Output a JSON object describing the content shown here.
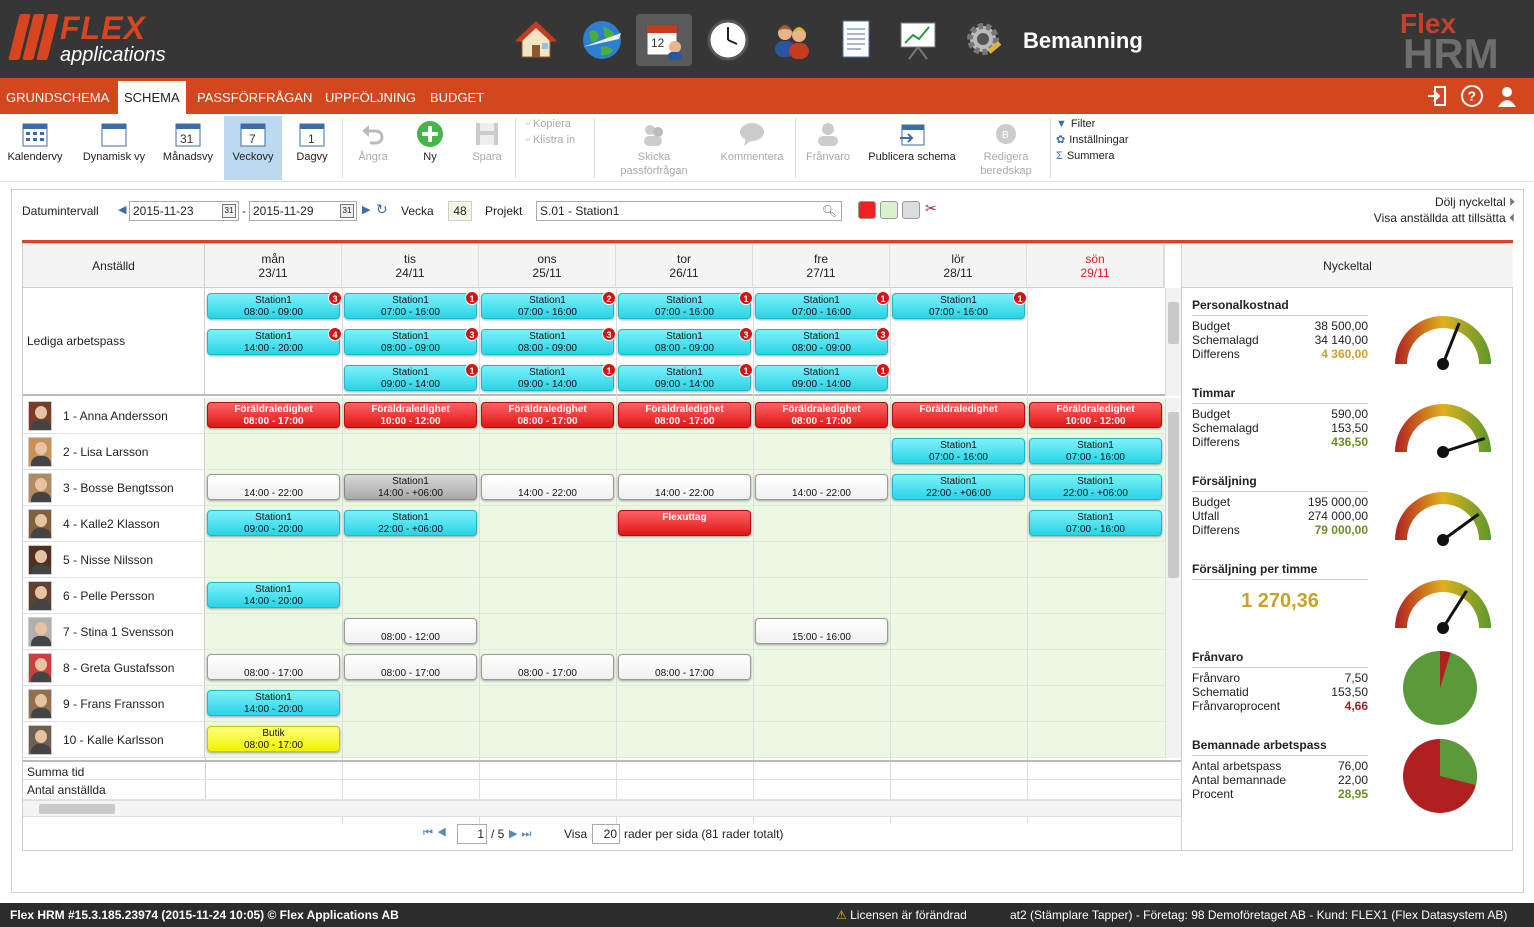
{
  "header": {
    "logo_text": "FLEX",
    "logo_sub": "applications",
    "app_title": "Bemanning",
    "brand_top": "Flex",
    "brand_bottom": "HRM"
  },
  "menu": {
    "tabs": [
      "GRUNDSCHEMA",
      "SCHEMA",
      "PASSFÖRFRÅGAN",
      "UPPFÖLJNING",
      "BUDGET"
    ],
    "active": "SCHEMA"
  },
  "toolbar": {
    "kalendervy": "Kalendervy",
    "dynamisk": "Dynamisk vy",
    "manadsvy": "Månadsvy",
    "veckovy": "Veckovy",
    "dagvy": "Dagvy",
    "angra": "Ångra",
    "ny": "Ny",
    "spara": "Spara",
    "kopiera": "Kopiera",
    "klistra": "Klistra in",
    "skicka1": "Skicka",
    "skicka2": "passförfrågan",
    "kommentera": "Kommentera",
    "franvaro": "Frånvaro",
    "publicera": "Publicera schema",
    "redigera1": "Redigera",
    "redigera2": "beredskap",
    "filter": "Filter",
    "installningar": "Inställningar",
    "summera": "Summera"
  },
  "filter": {
    "datumintervall": "Datumintervall",
    "from": "2015-11-23",
    "to": "2015-11-29",
    "vecka_label": "Vecka",
    "vecka": "48",
    "projekt_label": "Projekt",
    "projekt": "S.01 - Station1",
    "dolj": "Dölj nyckeltal",
    "visa": "Visa anställda att tillsätta"
  },
  "grid": {
    "emp_header": "Anställd",
    "lediga": "Lediga arbetspass",
    "summa": "Summa tid",
    "antal": "Antal anställda",
    "days": [
      {
        "d": "mån",
        "dt": "23/11"
      },
      {
        "d": "tis",
        "dt": "24/11"
      },
      {
        "d": "ons",
        "dt": "25/11"
      },
      {
        "d": "tor",
        "dt": "26/11"
      },
      {
        "d": "fre",
        "dt": "27/11"
      },
      {
        "d": "lör",
        "dt": "28/11"
      },
      {
        "d": "sön",
        "dt": "29/11"
      }
    ],
    "employees": [
      "1 - Anna Andersson",
      "2 - Lisa Larsson",
      "3 - Bosse Bengtsson",
      "4 - Kalle2 Klasson",
      "5 - Nisse Nilsson",
      "6 - Pelle Persson",
      "7 - Stina 1 Svensson",
      "8 - Greta Gustafsson",
      "9 - Frans Fransson",
      "10 - Kalle Karlsson"
    ]
  },
  "open_shifts": [
    {
      "day": 0,
      "slot": 0,
      "t1": "Station1",
      "t2": "08:00 - 09:00",
      "n": "3"
    },
    {
      "day": 1,
      "slot": 0,
      "t1": "Station1",
      "t2": "07:00 - 16:00",
      "n": "1"
    },
    {
      "day": 2,
      "slot": 0,
      "t1": "Station1",
      "t2": "07:00 - 16:00",
      "n": "2"
    },
    {
      "day": 3,
      "slot": 0,
      "t1": "Station1",
      "t2": "07:00 - 16:00",
      "n": "1"
    },
    {
      "day": 4,
      "slot": 0,
      "t1": "Station1",
      "t2": "07:00 - 16:00",
      "n": "1"
    },
    {
      "day": 5,
      "slot": 0,
      "t1": "Station1",
      "t2": "07:00 - 16:00",
      "n": "1"
    },
    {
      "day": 0,
      "slot": 1,
      "t1": "Station1",
      "t2": "14:00 - 20:00",
      "n": "4"
    },
    {
      "day": 1,
      "slot": 1,
      "t1": "Station1",
      "t2": "08:00 - 09:00",
      "n": "3"
    },
    {
      "day": 2,
      "slot": 1,
      "t1": "Station1",
      "t2": "08:00 - 09:00",
      "n": "3"
    },
    {
      "day": 3,
      "slot": 1,
      "t1": "Station1",
      "t2": "08:00 - 09:00",
      "n": "3"
    },
    {
      "day": 4,
      "slot": 1,
      "t1": "Station1",
      "t2": "08:00 - 09:00",
      "n": "3"
    },
    {
      "day": 1,
      "slot": 2,
      "t1": "Station1",
      "t2": "09:00 - 14:00",
      "n": "1"
    },
    {
      "day": 2,
      "slot": 2,
      "t1": "Station1",
      "t2": "09:00 - 14:00",
      "n": "1"
    },
    {
      "day": 3,
      "slot": 2,
      "t1": "Station1",
      "t2": "09:00 - 14:00",
      "n": "1"
    },
    {
      "day": 4,
      "slot": 2,
      "t1": "Station1",
      "t2": "09:00 - 14:00",
      "n": "1"
    }
  ],
  "shifts": [
    {
      "emp": 0,
      "day": 0,
      "c": "rd",
      "t1": "Föräldraledighet",
      "t2": "08:00 - 17:00"
    },
    {
      "emp": 0,
      "day": 1,
      "c": "rd",
      "t1": "Föräldraledighet",
      "t2": "10:00 - 12:00"
    },
    {
      "emp": 0,
      "day": 2,
      "c": "rd",
      "t1": "Föräldraledighet",
      "t2": "08:00 - 17:00"
    },
    {
      "emp": 0,
      "day": 3,
      "c": "rd",
      "t1": "Föräldraledighet",
      "t2": "08:00 - 17:00"
    },
    {
      "emp": 0,
      "day": 4,
      "c": "rd",
      "t1": "Föräldraledighet",
      "t2": "08:00 - 17:00"
    },
    {
      "emp": 0,
      "day": 5,
      "c": "rd",
      "t1": "Föräldraledighet",
      "t2": ""
    },
    {
      "emp": 0,
      "day": 6,
      "c": "rd",
      "t1": "Föräldraledighet",
      "t2": "10:00 - 12:00"
    },
    {
      "emp": 1,
      "day": 5,
      "c": "cy",
      "t1": "Station1",
      "t2": "07:00 - 16:00"
    },
    {
      "emp": 1,
      "day": 6,
      "c": "cy",
      "t1": "Station1",
      "t2": "07:00 - 16:00"
    },
    {
      "emp": 2,
      "day": 0,
      "c": "wh",
      "t1": "",
      "t2": "14:00 - 22:00"
    },
    {
      "emp": 2,
      "day": 1,
      "c": "gy",
      "t1": "Station1",
      "t2": "14:00 - +06:00"
    },
    {
      "emp": 2,
      "day": 2,
      "c": "wh",
      "t1": "",
      "t2": "14:00 - 22:00"
    },
    {
      "emp": 2,
      "day": 3,
      "c": "wh",
      "t1": "",
      "t2": "14:00 - 22:00"
    },
    {
      "emp": 2,
      "day": 4,
      "c": "wh",
      "t1": "",
      "t2": "14:00 - 22:00"
    },
    {
      "emp": 2,
      "day": 5,
      "c": "cy",
      "t1": "Station1",
      "t2": "22:00 - +06:00"
    },
    {
      "emp": 2,
      "day": 6,
      "c": "cy",
      "t1": "Station1",
      "t2": "22:00 - +06:00"
    },
    {
      "emp": 3,
      "day": 0,
      "c": "cy",
      "t1": "Station1",
      "t2": "09:00 - 20:00"
    },
    {
      "emp": 3,
      "day": 1,
      "c": "cy",
      "t1": "Station1",
      "t2": "22:00 - +06:00"
    },
    {
      "emp": 3,
      "day": 3,
      "c": "rd",
      "t1": "Flexuttag",
      "t2": ""
    },
    {
      "emp": 3,
      "day": 6,
      "c": "cy",
      "t1": "Station1",
      "t2": "07:00 - 16:00"
    },
    {
      "emp": 5,
      "day": 0,
      "c": "cy",
      "t1": "Station1",
      "t2": "14:00 - 20:00"
    },
    {
      "emp": 6,
      "day": 1,
      "c": "wh",
      "t1": "",
      "t2": "08:00 - 12:00"
    },
    {
      "emp": 6,
      "day": 4,
      "c": "wh",
      "t1": "",
      "t2": "15:00 - 16:00"
    },
    {
      "emp": 7,
      "day": 0,
      "c": "wh",
      "t1": "",
      "t2": "08:00 - 17:00"
    },
    {
      "emp": 7,
      "day": 1,
      "c": "wh",
      "t1": "",
      "t2": "08:00 - 17:00"
    },
    {
      "emp": 7,
      "day": 2,
      "c": "wh",
      "t1": "",
      "t2": "08:00 - 17:00"
    },
    {
      "emp": 7,
      "day": 3,
      "c": "wh",
      "t1": "",
      "t2": "08:00 - 17:00"
    },
    {
      "emp": 8,
      "day": 0,
      "c": "cy",
      "t1": "Station1",
      "t2": "14:00 - 20:00"
    },
    {
      "emp": 9,
      "day": 0,
      "c": "yl",
      "t1": "Butik",
      "t2": "08:00 - 17:00"
    }
  ],
  "pager": {
    "page": "1",
    "of": "/ 5",
    "visa": "Visa",
    "per": "20",
    "suffix": "rader per sida (81 rader totalt)"
  },
  "kpi": {
    "title": "Nyckeltal",
    "personal": {
      "t": "Personalkostnad",
      "r": [
        [
          "Budget",
          "38 500,00"
        ],
        [
          "Schemalagd",
          "34 140,00"
        ],
        [
          "Differens",
          "4 360,00"
        ]
      ],
      "level": 0.62
    },
    "timmar": {
      "t": "Timmar",
      "r": [
        [
          "Budget",
          "590,00"
        ],
        [
          "Schemalagd",
          "153,50"
        ],
        [
          "Differens",
          "436,50"
        ]
      ],
      "level": 0.9
    },
    "forsaljning": {
      "t": "Försäljning",
      "r": [
        [
          "Budget",
          "195 000,00"
        ],
        [
          "Utfall",
          "274 000,00"
        ],
        [
          "Differens",
          "79 000,00"
        ]
      ],
      "level": 0.8
    },
    "pertimme": {
      "t": "Försäljning per timme",
      "value": "1 270,36",
      "level": 0.68
    },
    "franvaro": {
      "t": "Frånvaro",
      "r": [
        [
          "Frånvaro",
          "7,50"
        ],
        [
          "Schematid",
          "153,50"
        ],
        [
          "Frånvaroprocent",
          "4,66"
        ]
      ],
      "pct": 4.66
    },
    "bemannade": {
      "t": "Bemannade arbetspass",
      "r": [
        [
          "Antal arbetspass",
          "76,00"
        ],
        [
          "Antal bemannade",
          "22,00"
        ],
        [
          "Procent",
          "28,95"
        ]
      ],
      "pct": 28.95
    }
  },
  "footer": {
    "left": "Flex HRM #15.3.185.23974 (2015-11-24 10:05) © Flex Applications AB",
    "warning": "Licensen är förändrad",
    "right": "at2 (Stämplare Tapper) - Företag: 98 Demoföretaget AB - Kund: FLEX1 (Flex Datasystem AB)"
  }
}
